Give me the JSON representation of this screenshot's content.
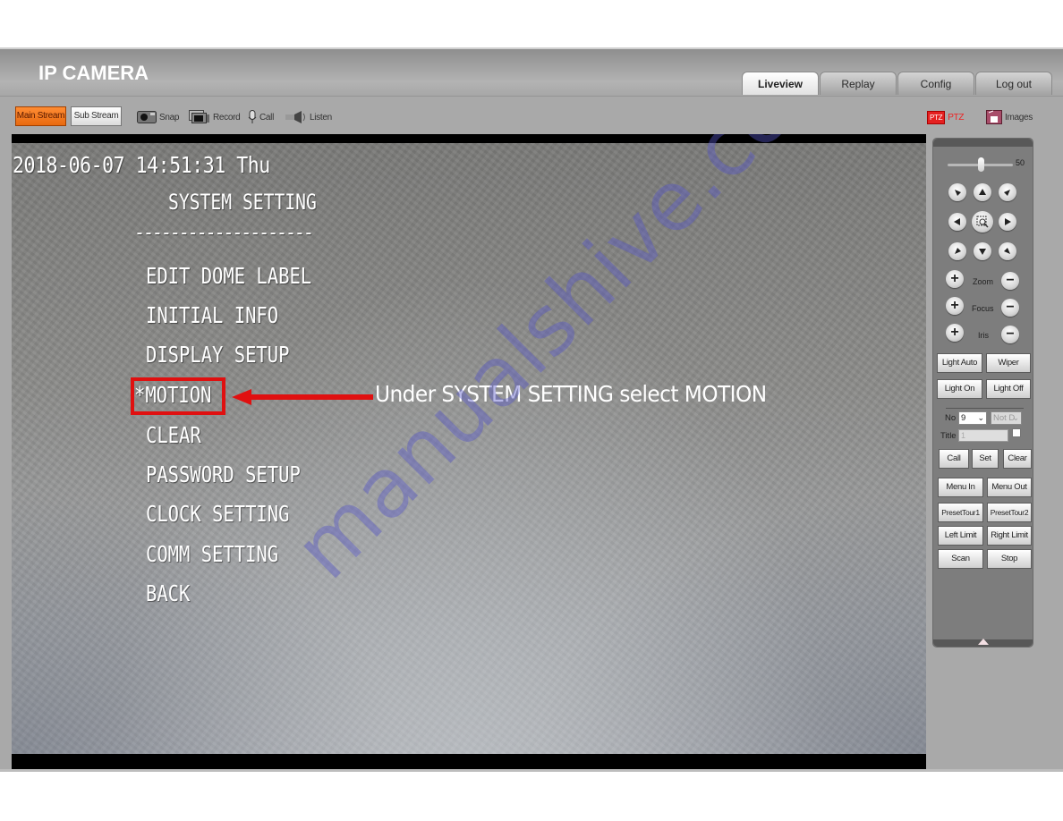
{
  "app": {
    "title": "IP CAMERA",
    "tabs": [
      {
        "label": "Liveview",
        "active": true
      },
      {
        "label": "Replay",
        "active": false
      },
      {
        "label": "Config",
        "active": false
      },
      {
        "label": "Log out",
        "active": false
      }
    ]
  },
  "toolbar": {
    "main_stream": "Main Stream",
    "sub_stream": "Sub Stream",
    "snap": "Snap",
    "record": "Record",
    "call": "Call",
    "listen": "Listen",
    "ptz": "PTZ",
    "ptz_badge": "PTZ",
    "images": "Images",
    "accent_color": "#f07a1e"
  },
  "video": {
    "timestamp": "2018-06-07 14:51:31 Thu",
    "menu_title": "SYSTEM SETTING",
    "separator": "--------------------",
    "menu_items": [
      "EDIT DOME LABEL",
      "INITIAL INFO",
      "DISPLAY SETUP",
      "*MOTION",
      "CLEAR",
      "PASSWORD SETUP",
      "CLOCK SETTING",
      "COMM SETTING",
      "BACK"
    ],
    "selected_item": "*MOTION",
    "annotation": "Under SYSTEM SETTING select MOTION",
    "annotation_color": "#e01010",
    "watermark": "manualshive.com"
  },
  "ptz": {
    "speed_value": "50",
    "speed_fraction": 0.5,
    "zoom_label": "Zoom",
    "focus_label": "Focus",
    "iris_label": "Iris",
    "light_auto": "Light Auto",
    "wiper": "Wiper",
    "light_on": "Light On",
    "light_off": "Light Off",
    "no_label": "No",
    "no_value": "9",
    "preset_state": "Not D",
    "title_label": "Title",
    "title_value": "1",
    "call": "Call",
    "set": "Set",
    "clear": "Clear",
    "menu_in": "Menu In",
    "menu_out": "Menu Out",
    "preset_tour1": "PresetTour1",
    "preset_tour2": "PresetTour2",
    "left_limit": "Left Limit",
    "right_limit": "Right Limit",
    "scan": "Scan",
    "stop": "Stop"
  }
}
